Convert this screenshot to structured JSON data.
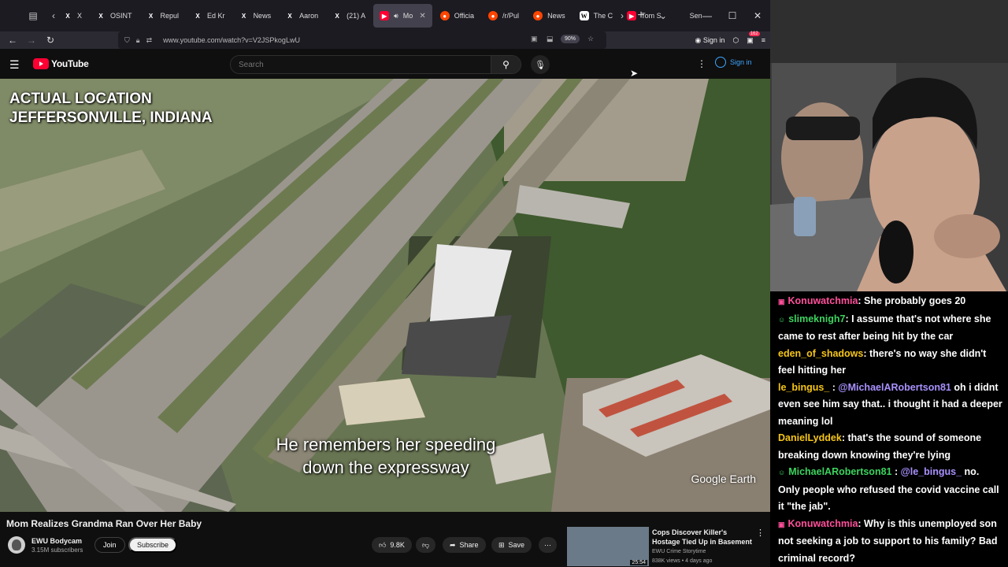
{
  "browser": {
    "tabs": [
      {
        "label": "X",
        "icon": "x-logo-icon"
      },
      {
        "label": "OSINT",
        "icon": "x-logo-icon"
      },
      {
        "label": "Repul",
        "icon": "x-logo-icon"
      },
      {
        "label": "Ed Kr",
        "icon": "x-logo-icon"
      },
      {
        "label": "News",
        "icon": "x-logo-icon"
      },
      {
        "label": "Aaron",
        "icon": "x-logo-icon"
      },
      {
        "label": "(21) A",
        "icon": "x-logo-icon"
      },
      {
        "label": "Mo",
        "icon": "youtube-icon"
      },
      {
        "label": "Officia",
        "icon": "reddit-icon"
      },
      {
        "label": "/r/Pul",
        "icon": "reddit-icon"
      },
      {
        "label": "News",
        "icon": "reddit-icon"
      },
      {
        "label": "The C",
        "icon": "wikipedia-icon"
      },
      {
        "label": "Tom S",
        "icon": "youtube-icon"
      },
      {
        "label": "Sen",
        "icon": "tab-icon"
      }
    ],
    "url": "www.youtube.com/watch?v=V2JSPkogLwU",
    "zoom": "90%",
    "sign_in": "Sign in",
    "badge_count": "162"
  },
  "youtube": {
    "logo_text": "YouTube",
    "search_placeholder": "Search",
    "sign_in": "Sign in"
  },
  "video": {
    "overlay_line1": "ACTUAL LOCATION",
    "overlay_line2": "JEFFERSONVILLE, INDIANA",
    "subtitle_line1": "He remembers her speeding",
    "subtitle_line2": "down the expressway",
    "watermark": "Google Earth",
    "title": "Mom Realizes Grandma Ran Over Her Baby",
    "channel": "EWU Bodycam",
    "subscribers": "3.15M subscribers",
    "join": "Join",
    "subscribe": "Subscribe",
    "likes": "9.8K",
    "share": "Share",
    "save": "Save"
  },
  "recommendation": {
    "title": "Cops Discover Killer's Hostage Tied Up in Basement",
    "channel": "EWU Crime Storytime",
    "meta": "838K views • 4 days ago",
    "duration": "25:54"
  },
  "chat": [
    {
      "user": "Konuwatchmia",
      "color": "#ff4f9a",
      "icon": "tv-icon",
      "text": ": She probably goes 20"
    },
    {
      "user": "slimeknigh7",
      "color": "#3cd35f",
      "icon": "user-icon",
      "text": ": I assume that's not where she came to rest after being hit by the car"
    },
    {
      "user": "eden_of_shadows",
      "color": "#f5c518",
      "icon": "",
      "text": ": there's no way she didn't feel hitting her"
    },
    {
      "user": "le_bingus_",
      "color": "#f5c518",
      "icon": "",
      "mention": "@MichaelARobertson81",
      "text": " oh i didnt even see him say that.. i thought it had a deeper meaning lol"
    },
    {
      "user": "DanielLyddek",
      "color": "#f5c518",
      "icon": "",
      "text": ": that's the sound of someone breaking down knowing they're lying"
    },
    {
      "user": "MichaelARobertson81",
      "color": "#3cd35f",
      "icon": "user-icon",
      "mention": "@le_bingus_",
      "text": " no. Only people who refused the covid vaccine call it \"the jab\"."
    },
    {
      "user": "Konuwatchmia",
      "color": "#ff4f9a",
      "icon": "tv-icon",
      "text": ": Why is this unemployed son not seeking a job to support to his family? Bad criminal record?"
    }
  ]
}
